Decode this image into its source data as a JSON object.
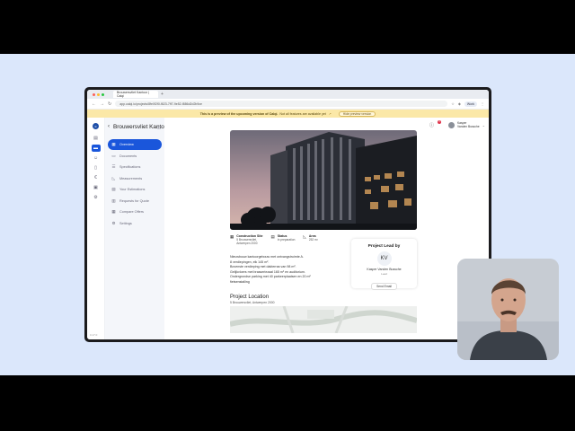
{
  "browser": {
    "tab_title": "Brouwersvliet Kantoor | Calqi",
    "new_tab_icon": "+",
    "url": "app.calqi.io/projects/8fe0f2f0-f823-7ff7-9e52-f886d2d2b9ce",
    "profile_chip": "Work"
  },
  "banner": {
    "bold": "This is a preview of the upcoming version of Calqi.",
    "text": "Not all features are available yet",
    "button": "Hide preview version"
  },
  "project": {
    "title": "Brouwersvliet Kantoor",
    "version": "0.17.0"
  },
  "menu": [
    {
      "label": "Overview",
      "icon": "overview-icon",
      "glyph": "▦",
      "active": true
    },
    {
      "label": "Documents",
      "icon": "folder-icon",
      "glyph": "▭",
      "active": false
    },
    {
      "label": "Specifications",
      "icon": "list-icon",
      "glyph": "☰",
      "active": false
    },
    {
      "label": "Measurements",
      "icon": "ruler-icon",
      "glyph": "◺",
      "active": false
    },
    {
      "label": "Your Estimations",
      "icon": "calculator-icon",
      "glyph": "▤",
      "active": false
    },
    {
      "label": "Requests for Quote",
      "icon": "quote-icon",
      "glyph": "▥",
      "active": false
    },
    {
      "label": "Compare Offers",
      "icon": "compare-icon",
      "glyph": "▦",
      "active": false
    },
    {
      "label": "Settings",
      "icon": "gear-icon",
      "glyph": "⚙",
      "active": false
    }
  ],
  "user": {
    "name_line1": "Kasper",
    "name_line2": "Vanden Bussche",
    "notifications": "3"
  },
  "facts": [
    {
      "label": "Construction Site",
      "value1": "5 Brouwersvliet,",
      "value2": "Antwerpen 2000"
    },
    {
      "label": "Status",
      "value1": "In preparation",
      "value2": ""
    },
    {
      "label": "Area",
      "value1": "252 m²",
      "value2": ""
    }
  ],
  "description": [
    "Nieuwbouw kantoorgebouw met ontvangstruimte A.",
    "8 verdiepingen, elk 145 m².",
    "Bovenste verdieping met dakterras van 98 m².",
    "Gelijkvloers met brasseriezaal 165 m² en auditorium.",
    "Ondergrondse parking met 40 parkeerplaatsen en 20 m²",
    "fietsenstalling"
  ],
  "lead": {
    "title": "Project Lead by",
    "initials": "KV",
    "name": "Kasper Vanden Bussche",
    "role": "Lead",
    "email_button": "Send Email"
  },
  "location": {
    "title": "Project Location",
    "address": "5 Brouwersvliet, Antwerpen 2000"
  },
  "colors": {
    "accent": "#1a56db",
    "banner": "#fbe8a7",
    "background": "#dbe7fb"
  }
}
